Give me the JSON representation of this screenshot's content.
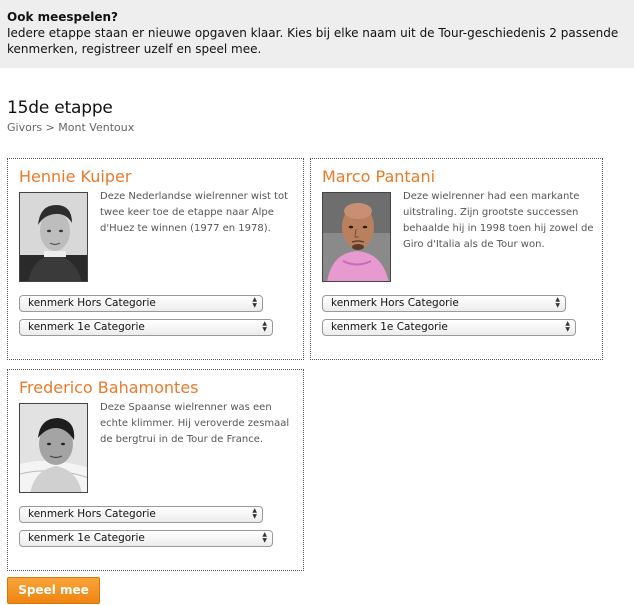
{
  "intro": {
    "title": "Ook meespelen?",
    "text": "Iedere etappe staan er nieuwe opgaven klaar. Kies bij elke naam uit de Tour-geschiedenis 2 passende kenmerken, registreer uzelf en speel mee."
  },
  "stage": {
    "title": "15de etappe",
    "route": "Givors > Mont Ventoux"
  },
  "riders": [
    {
      "name": "Hennie Kuiper",
      "description": "Deze Nederlandse wielrenner wist tot twee keer toe de etappe naar Alpe d'Huez te winnen (1977 en 1978).",
      "select1": "kenmerk Hors Categorie",
      "select2": "kenmerk 1e Categorie"
    },
    {
      "name": "Marco Pantani",
      "description": "Deze wielrenner had een markante uitstraling. Zijn grootste successen behaalde hij in 1998 toen hij zowel de Giro d'Italia als de Tour won.",
      "select1": "kenmerk Hors Categorie",
      "select2": "kenmerk 1e Categorie"
    },
    {
      "name": "Frederico Bahamontes",
      "description": "Deze Spaanse wielrenner was een echte klimmer. Hij veroverde zesmaal de bergtrui in de Tour de France.",
      "select1": "kenmerk Hors Categorie",
      "select2": "kenmerk 1e Categorie"
    }
  ],
  "play_button": "Speel mee",
  "colors": {
    "accent": "#ea7a2a",
    "button": "#f39422",
    "intro_background": "#eeeeee"
  }
}
